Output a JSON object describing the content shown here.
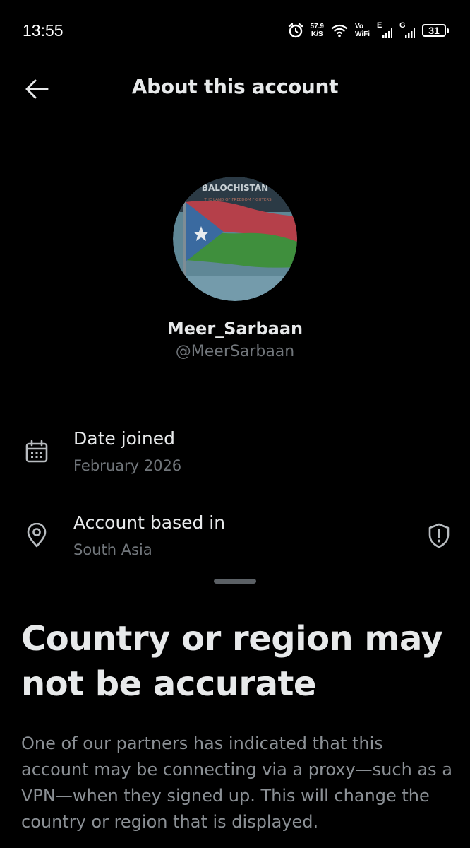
{
  "status_bar": {
    "time": "13:55",
    "speed_value": "57.9",
    "speed_unit": "K/S",
    "vo_label": "Vo",
    "wifi_label": "WiFi",
    "network1_label": "E",
    "network2_label": "G",
    "battery_level": "31"
  },
  "header": {
    "title": "About this account"
  },
  "profile": {
    "display_name": "Meer_Sarbaan",
    "handle": "@MeerSarbaan",
    "avatar_text_top": "BALOCHISTAN",
    "avatar_text_sub": "THE LAND OF FREEDOM FIGHTERS"
  },
  "info": {
    "date_joined_label": "Date joined",
    "date_joined_value": "February 2026",
    "based_in_label": "Account based in",
    "based_in_value": "South Asia"
  },
  "sheet": {
    "title": "Country or region may not be accurate",
    "body": "One of our partners has indicated that this account may be connecting via a proxy—such as a VPN—when they signed up. This will change the country or region that is displayed."
  },
  "colors": {
    "background": "#000000",
    "primary_text": "#e7e9ea",
    "secondary_text": "#71767b",
    "icon": "#b8bcc0"
  }
}
